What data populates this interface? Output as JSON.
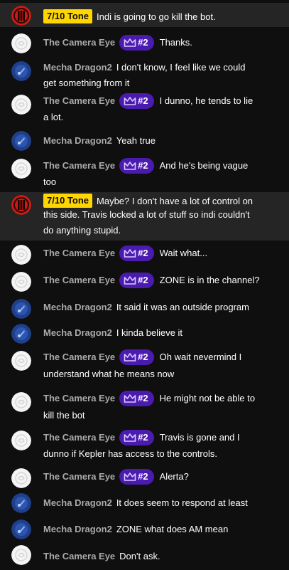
{
  "messages": [
    {
      "avatar": "red-logo",
      "badge_type": "tone",
      "badge": "7/10 Tone",
      "author": "",
      "lines": [
        "Indi is going to go kill the bot."
      ]
    },
    {
      "avatar": "white-logo",
      "badge_type": "member",
      "badge": "#2",
      "author": "The Camera Eye",
      "lines": [
        "Thanks."
      ]
    },
    {
      "avatar": "blue-logo",
      "badge_type": "none",
      "badge": "",
      "author": "Mecha Dragon2",
      "lines": [
        "I don't know, I feel like we could",
        "get something from it"
      ]
    },
    {
      "avatar": "white-logo",
      "badge_type": "member",
      "badge": "#2",
      "author": "The Camera Eye",
      "lines": [
        "I dunno, he tends to lie",
        "a lot."
      ]
    },
    {
      "avatar": "blue-logo",
      "badge_type": "none",
      "badge": "",
      "author": "Mecha Dragon2",
      "lines": [
        "Yeah true"
      ]
    },
    {
      "avatar": "white-logo",
      "badge_type": "member",
      "badge": "#2",
      "author": "The Camera Eye",
      "lines": [
        "And he's being vague",
        "too"
      ]
    },
    {
      "avatar": "red-logo",
      "badge_type": "tone",
      "badge": "7/10 Tone",
      "author": "",
      "lines": [
        "Maybe? I don't have a lot of control on",
        "this side. Travis locked a lot of stuff so indi couldn't",
        "do anything stupid."
      ]
    },
    {
      "avatar": "white-logo",
      "badge_type": "member",
      "badge": "#2",
      "author": "The Camera Eye",
      "lines": [
        "Wait what..."
      ]
    },
    {
      "avatar": "white-logo",
      "badge_type": "member",
      "badge": "#2",
      "author": "The Camera Eye",
      "lines": [
        "ZONE is in the channel?"
      ]
    },
    {
      "avatar": "blue-logo",
      "badge_type": "none",
      "badge": "",
      "author": "Mecha Dragon2",
      "lines": [
        "It said it was an outside program"
      ]
    },
    {
      "avatar": "blue-logo",
      "badge_type": "none",
      "badge": "",
      "author": "Mecha Dragon2",
      "lines": [
        "I kinda believe it"
      ]
    },
    {
      "avatar": "white-logo",
      "badge_type": "member",
      "badge": "#2",
      "author": "The Camera Eye",
      "lines": [
        "Oh wait nevermind I",
        "understand what he means now"
      ]
    },
    {
      "avatar": "white-logo",
      "badge_type": "member",
      "badge": "#2",
      "author": "The Camera Eye",
      "lines": [
        "He might not be able to",
        "kill the bot"
      ]
    },
    {
      "avatar": "white-logo",
      "badge_type": "member",
      "badge": "#2",
      "author": "The Camera Eye",
      "lines": [
        "Travis is gone and I",
        "dunno if Kepler has access to the controls."
      ]
    },
    {
      "avatar": "white-logo",
      "badge_type": "member",
      "badge": "#2",
      "author": "The Camera Eye",
      "lines": [
        "Alerta?"
      ]
    },
    {
      "avatar": "blue-logo",
      "badge_type": "none",
      "badge": "",
      "author": "Mecha Dragon2",
      "lines": [
        "It does seem to respond at least"
      ]
    },
    {
      "avatar": "blue-logo",
      "badge_type": "none",
      "badge": "",
      "author": "Mecha Dragon2",
      "lines": [
        "ZONE what does AM mean"
      ]
    },
    {
      "avatar": "white-logo",
      "badge_type": "none",
      "badge": "",
      "author": "The Camera Eye",
      "lines": [
        "Don't ask."
      ]
    }
  ],
  "colors": {
    "background": "#0f0f0f",
    "highlight_row": "#252525",
    "author": "#aaaaaa",
    "tone_badge": "#ffd600",
    "member_badge": "#4b1bb0"
  }
}
